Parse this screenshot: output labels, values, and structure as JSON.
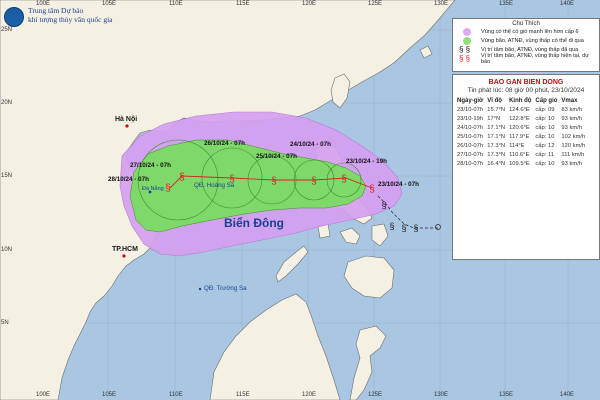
{
  "header": {
    "line1": "Trung tâm Dự báo",
    "line2": "khí tượng thủy văn quốc gia"
  },
  "legend": {
    "title": "Chú Thích",
    "items": [
      {
        "label": "Vùng có thể có gió mạnh lên hơn cấp 6",
        "symbol": "pink-circle-icon",
        "color": "#e3a6f2"
      },
      {
        "label": "Vùng bão, ATNĐ, vùng thấp có thể đi qua",
        "symbol": "green-circle-icon",
        "color": "#8fe07a"
      },
      {
        "label": "Vị trí tâm bão, ATNĐ, vùng thấp đã qua",
        "symbol": "black-typhoon-icon",
        "color": "#111111"
      },
      {
        "label": "Vị trí tâm bão, ATNĐ, vùng thấp hiện tại, dự báo",
        "symbol": "red-typhoon-icon",
        "color": "#e02020"
      }
    ]
  },
  "bulletin": {
    "title": "BAO GAN BIEN DONG",
    "issued": "Tin phát lúc: 08 giờ 00 phút, 23/10/2024",
    "columns": [
      "Ngày-giờ",
      "Vĩ độ",
      "Kinh độ",
      "Cấp gió",
      "Vmax"
    ],
    "rows": [
      [
        "23/10-07h",
        "15.7°N",
        "124.6°E",
        "cấp: 09",
        "83 km/h"
      ],
      [
        "23/10-19h",
        "17°N",
        "122.8°E",
        "cấp: 10",
        "93 km/h"
      ],
      [
        "24/10-07h",
        "17.1°N",
        "120.6°E",
        "cấp: 10",
        "93 km/h"
      ],
      [
        "25/10-07h",
        "17.1°N",
        "117.9°E",
        "cấp: 10",
        "102 km/h"
      ],
      [
        "26/10-07h",
        "17.3°N",
        "114°E",
        "cấp: 12",
        "120 km/h"
      ],
      [
        "27/10-07h",
        "17.3°N",
        "110.6°E",
        "cấp: 11",
        "111 km/h"
      ],
      [
        "28/10-07h",
        "16.4°N",
        "109.5°E",
        "cấp: 10",
        "93 km/h"
      ]
    ]
  },
  "map": {
    "lon_ticks": [
      "100E",
      "105E",
      "110E",
      "115E",
      "120E",
      "125E",
      "130E",
      "135E",
      "140E"
    ],
    "lat_ticks": [
      "25N",
      "20N",
      "15N",
      "10N",
      "5N"
    ],
    "sea_label": "Biển Đông",
    "places": {
      "hanoi": "Hà Nội",
      "danang": "Đà Nẵng",
      "hcm": "TP.HCM",
      "paracel": "QĐ. Hoàng Sa",
      "spratly": "QĐ. Trường Sa"
    },
    "forecast_labels": [
      "28/10/24 - 07h",
      "27/10/24 - 07h",
      "26/10/24 - 07h",
      "25/10/24 - 07h",
      "24/10/24 - 07h",
      "23/10/24 - 19h",
      "23/10/24 - 07h"
    ],
    "colors": {
      "sea": "#a9c7e3",
      "land": "#f4f0e4",
      "wind_zone": "#d59ef0",
      "track_zone": "#7fd96a",
      "track_line": "#e02020"
    }
  }
}
